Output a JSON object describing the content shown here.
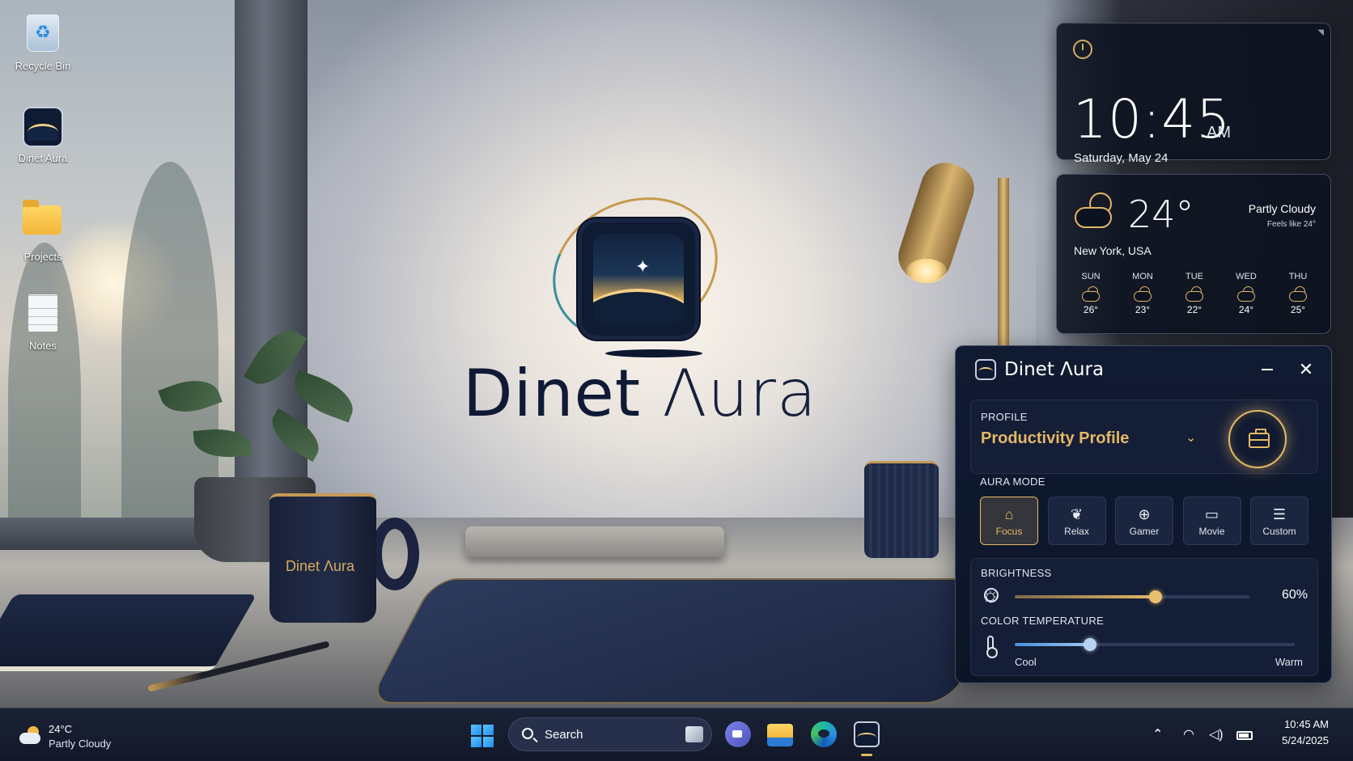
{
  "desktop": {
    "icons": [
      {
        "label": "Recycle Bin",
        "icon": "recycle-bin-icon"
      },
      {
        "label": "Dinet Aura",
        "icon": "dinet-aura-app-icon"
      },
      {
        "label": "Projects",
        "icon": "folder-icon"
      },
      {
        "label": "Notes",
        "icon": "text-document-icon"
      }
    ]
  },
  "wallpaper": {
    "logo_word_bold": "Dinet",
    "logo_word_light": "Λura",
    "mug_text": "Dinet Λura"
  },
  "clock_widget": {
    "time": "10:45",
    "ampm": "AM",
    "date": "Saturday, May 24"
  },
  "weather_widget": {
    "temperature": "24°",
    "condition": "Partly Cloudy",
    "feels_like": "Feels like 24°",
    "location": "New York, USA",
    "forecast": [
      {
        "day": "SUN",
        "temp": "26°",
        "icon": "partly-cloudy-icon"
      },
      {
        "day": "MON",
        "temp": "23°",
        "icon": "partly-cloudy-icon"
      },
      {
        "day": "TUE",
        "temp": "22°",
        "icon": "partly-cloudy-icon"
      },
      {
        "day": "WED",
        "temp": "24°",
        "icon": "partly-cloudy-icon"
      },
      {
        "day": "THU",
        "temp": "25°",
        "icon": "partly-cloudy-icon"
      }
    ]
  },
  "aura_panel": {
    "title_bold": "Dinet",
    "title_light": "Λura",
    "profile": {
      "label": "PROFILE",
      "selected": "Productivity Profile",
      "icon": "briefcase-icon"
    },
    "aura_mode": {
      "label": "AURA MODE",
      "modes": [
        {
          "label": "Focus",
          "icon": "focus-icon",
          "active": true
        },
        {
          "label": "Relax",
          "icon": "leaf-icon",
          "active": false
        },
        {
          "label": "Gamer",
          "icon": "gamepad-icon",
          "active": false
        },
        {
          "label": "Movie",
          "icon": "monitor-icon",
          "active": false
        },
        {
          "label": "Custom",
          "icon": "sliders-icon",
          "active": false
        }
      ]
    },
    "brightness": {
      "label": "BRIGHTNESS",
      "value": 60,
      "display": "60%"
    },
    "color_temperature": {
      "label": "COLOR TEMPERATURE",
      "value": 0.27,
      "min_label": "Cool",
      "max_label": "Warm"
    }
  },
  "taskbar": {
    "weather_temp": "24°C",
    "weather_condition": "Partly Cloudy",
    "search_placeholder": "Search",
    "time": "10:45 AM",
    "date": "5/24/2025"
  },
  "colors": {
    "accent_gold": "#e4b865",
    "panel_bg": "#101a31",
    "cool_blue": "#4a8fe0"
  }
}
